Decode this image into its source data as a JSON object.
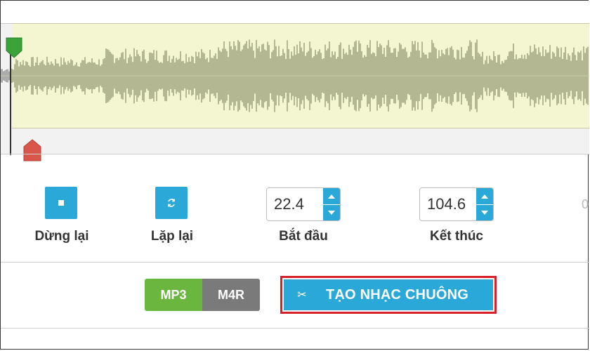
{
  "controls": {
    "stop_label": "Dừng lại",
    "loop_label": "Lặp lại",
    "start_label": "Bắt đầu",
    "start_value": "22.4",
    "end_label": "Kết thúc",
    "end_value": "104.6"
  },
  "format": {
    "options": [
      "MP3",
      "M4R"
    ],
    "selected": "MP3"
  },
  "create_button": {
    "label": "TẠO NHẠC CHUÔNG",
    "icon": "scissors-icon"
  },
  "icons": {
    "stop": "stop-icon",
    "loop": "loop-icon",
    "start_marker": "start-marker-icon",
    "end_marker": "end-marker-icon"
  },
  "colors": {
    "accent_blue": "#2aa8d8",
    "mp3_green": "#6bb63f",
    "m4r_grey": "#7a7a7a",
    "highlight_red": "#d4202a",
    "waveform": "#a3a882",
    "selection_bg": "#f4f6d2",
    "start_marker": "#3aa43a",
    "end_marker": "#d9574a"
  }
}
